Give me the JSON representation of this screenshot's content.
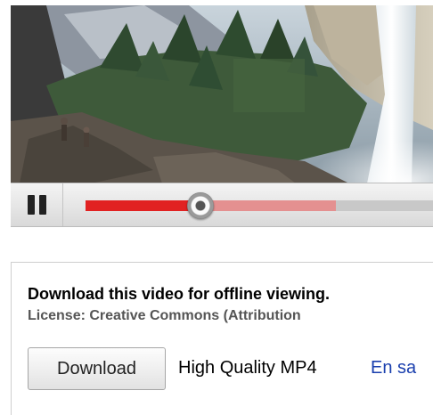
{
  "player": {
    "progress_played": 0.33,
    "progress_buffered": 0.72,
    "pause_icon": "pause-icon",
    "colors": {
      "played": "#e12222",
      "buffered": "#e49090",
      "track": "#c8c8c8"
    }
  },
  "download_panel": {
    "title": "Download this video for offline viewing.",
    "license": "License: Creative Commons (Attribution",
    "download_label": "Download",
    "format": "High Quality MP4",
    "learn_more": "En sa"
  }
}
